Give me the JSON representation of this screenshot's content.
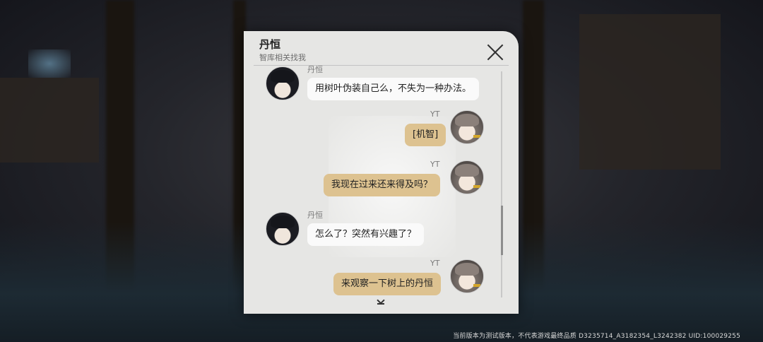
{
  "panel": {
    "title": "丹恒",
    "subtitle": "智库相关找我"
  },
  "messages": [
    {
      "sender": "丹恒",
      "side": "left",
      "text": "用树叶伪装自己么，不失为一种办法。"
    },
    {
      "sender": "YT",
      "side": "right",
      "text": "[机智]"
    },
    {
      "sender": "YT",
      "side": "right",
      "text": "我现在过来还来得及吗？"
    },
    {
      "sender": "丹恒",
      "side": "left",
      "text": "怎么了？突然有兴趣了？"
    },
    {
      "sender": "YT",
      "side": "right",
      "text": "来观察一下树上的丹恒"
    }
  ],
  "footer": {
    "build_info": "当前版本为测试版本，不代表游戏最终品质 D3235714_A3182354_L3242382 UID:100029255"
  },
  "colors": {
    "panel_bg": "#e6e6e4",
    "bubble_left": "#fafafa",
    "bubble_right": "#ddc290"
  }
}
